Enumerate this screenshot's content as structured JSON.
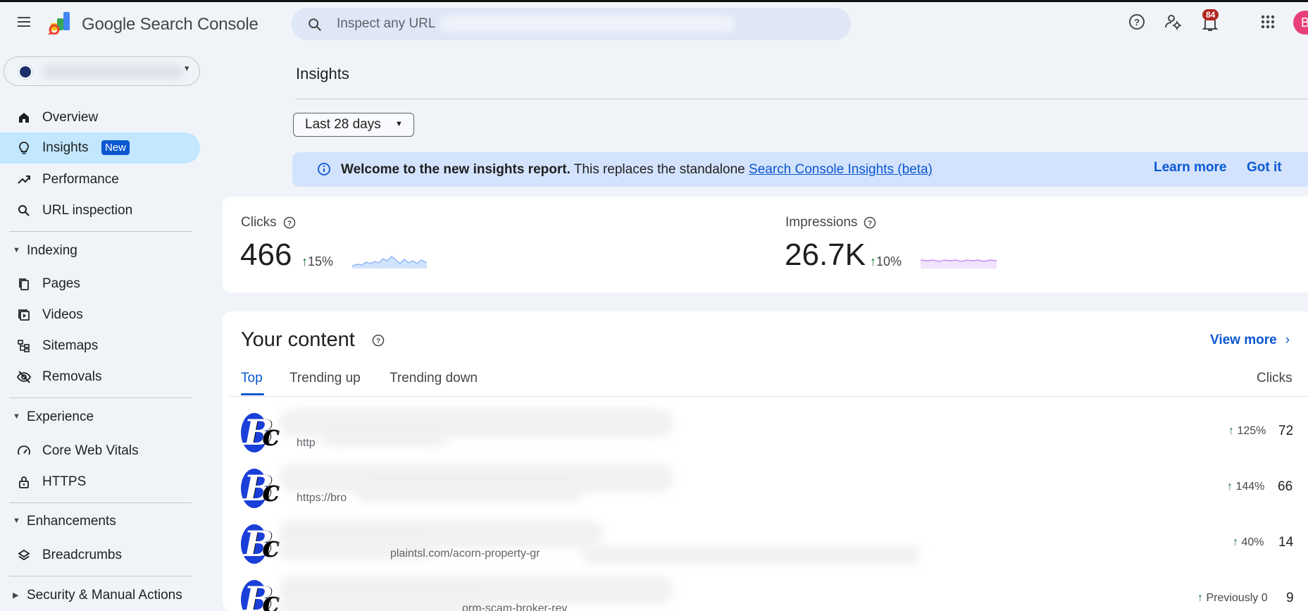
{
  "header": {
    "app_title": "Google Search Console",
    "search_placeholder": "Inspect any URL",
    "notification_count": "84",
    "avatar_initial": "B"
  },
  "sidebar": {
    "nav": [
      {
        "label": "Overview",
        "icon": "home-icon"
      },
      {
        "label": "Insights",
        "icon": "lightbulb-icon",
        "badge": "New",
        "active": true
      },
      {
        "label": "Performance",
        "icon": "trending-icon"
      },
      {
        "label": "URL inspection",
        "icon": "search-icon"
      }
    ],
    "sections": [
      {
        "title": "Indexing",
        "items": [
          "Pages",
          "Videos",
          "Sitemaps",
          "Removals"
        ]
      },
      {
        "title": "Experience",
        "items": [
          "Core Web Vitals",
          "HTTPS"
        ]
      },
      {
        "title": "Enhancements",
        "items": [
          "Breadcrumbs"
        ]
      },
      {
        "title": "Security & Manual Actions",
        "items": []
      }
    ]
  },
  "main": {
    "page_title": "Insights",
    "date_range": "Last 28 days",
    "banner": {
      "bold": "Welcome to the new insights report.",
      "text": " This replaces the standalone ",
      "link": "Search Console Insights (beta)",
      "learn_more": "Learn more",
      "got_it": "Got it"
    },
    "metrics": [
      {
        "label": "Clicks",
        "value": "466",
        "delta": "15%",
        "color": "#8ab4f8"
      },
      {
        "label": "Impressions",
        "value": "26.7K",
        "delta": "10%",
        "color": "#c58af9"
      }
    ],
    "content": {
      "title": "Your content",
      "view_more": "View more",
      "tabs": [
        "Top",
        "Trending up",
        "Trending down"
      ],
      "column": "Clicks",
      "rows": [
        {
          "url": "http",
          "delta": "125%",
          "clicks": "72"
        },
        {
          "url": "https://bro",
          "delta": "144%",
          "clicks": "66"
        },
        {
          "url": "plaintsl.com/acorn-property-gr",
          "delta": "40%",
          "clicks": "14"
        },
        {
          "url": "orm-scam-broker-rev",
          "delta": "Previously 0",
          "clicks": "9"
        }
      ]
    }
  },
  "colors": {
    "accent": "#0b57d0",
    "active_nav": "#c2e7ff",
    "banner_bg": "#d3e3fd",
    "positive": "#137333",
    "page_bg": "#f0f4f9"
  }
}
